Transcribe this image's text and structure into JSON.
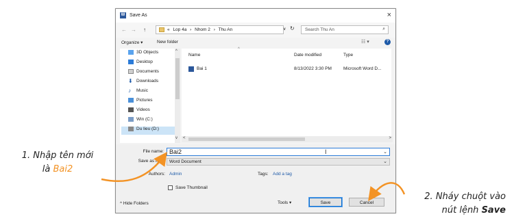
{
  "dialog": {
    "title": "Save As",
    "close_glyph": "×",
    "app_icon_glyph": "W",
    "nav": {
      "back": "←",
      "forward": "→",
      "up": "↑"
    },
    "breadcrumb": [
      "«",
      "Lop 4a",
      "›",
      "Nhom 2",
      "›",
      "Thu An"
    ],
    "address_dropdown": "∨",
    "refresh_glyph": "↻",
    "search_placeholder": "Search Thu An",
    "search_glyph": "⌕",
    "toolbar": {
      "organize": "Organize ▾",
      "new_folder": "New folder",
      "view": "☷ ▾",
      "help": "?"
    },
    "nav_items": [
      {
        "label": "3D Objects",
        "icon": "cube-icon"
      },
      {
        "label": "Desktop",
        "icon": "desktop-icon"
      },
      {
        "label": "Documents",
        "icon": "documents-icon"
      },
      {
        "label": "Downloads",
        "icon": "download-icon"
      },
      {
        "label": "Music",
        "icon": "music-icon"
      },
      {
        "label": "Pictures",
        "icon": "pictures-icon"
      },
      {
        "label": "Videos",
        "icon": "videos-icon"
      },
      {
        "label": "Win (C:)",
        "icon": "drive-icon"
      },
      {
        "label": "Du lieu (D:)",
        "icon": "drive-icon"
      }
    ],
    "columns": {
      "name": "Name",
      "date": "Date modified",
      "type": "Type"
    },
    "files": [
      {
        "name": "Bai 1",
        "date": "8/13/2022 3:30 PM",
        "type": "Microsoft Word D..."
      }
    ],
    "form": {
      "file_name_label": "File name:",
      "file_name_value": "Bai2",
      "save_as_type_label": "Save as type:",
      "save_as_type_value": "Word Document",
      "authors_label": "Authors:",
      "authors_value": "Admin",
      "tags_label": "Tags:",
      "tags_value": "Add a tag",
      "thumbnail_label": "Save Thumbnail"
    },
    "footer": {
      "hide_folders": "^ Hide Folders",
      "tools": "Tools ▾",
      "save": "Save",
      "cancel": "Cancel"
    },
    "colors": {
      "accent": "#0f6fce",
      "selection": "#cce4f7",
      "link": "#1e5aa8"
    }
  },
  "annotations": {
    "left_line1": "1. Nhập tên mới",
    "left_line2_prefix": "là ",
    "left_line2_highlight": "Bai2",
    "right_line1": "2. Nháy chuột vào",
    "right_line2_prefix": "nút lệnh ",
    "right_line2_bold": "Save",
    "arrow_color": "#f39325"
  }
}
